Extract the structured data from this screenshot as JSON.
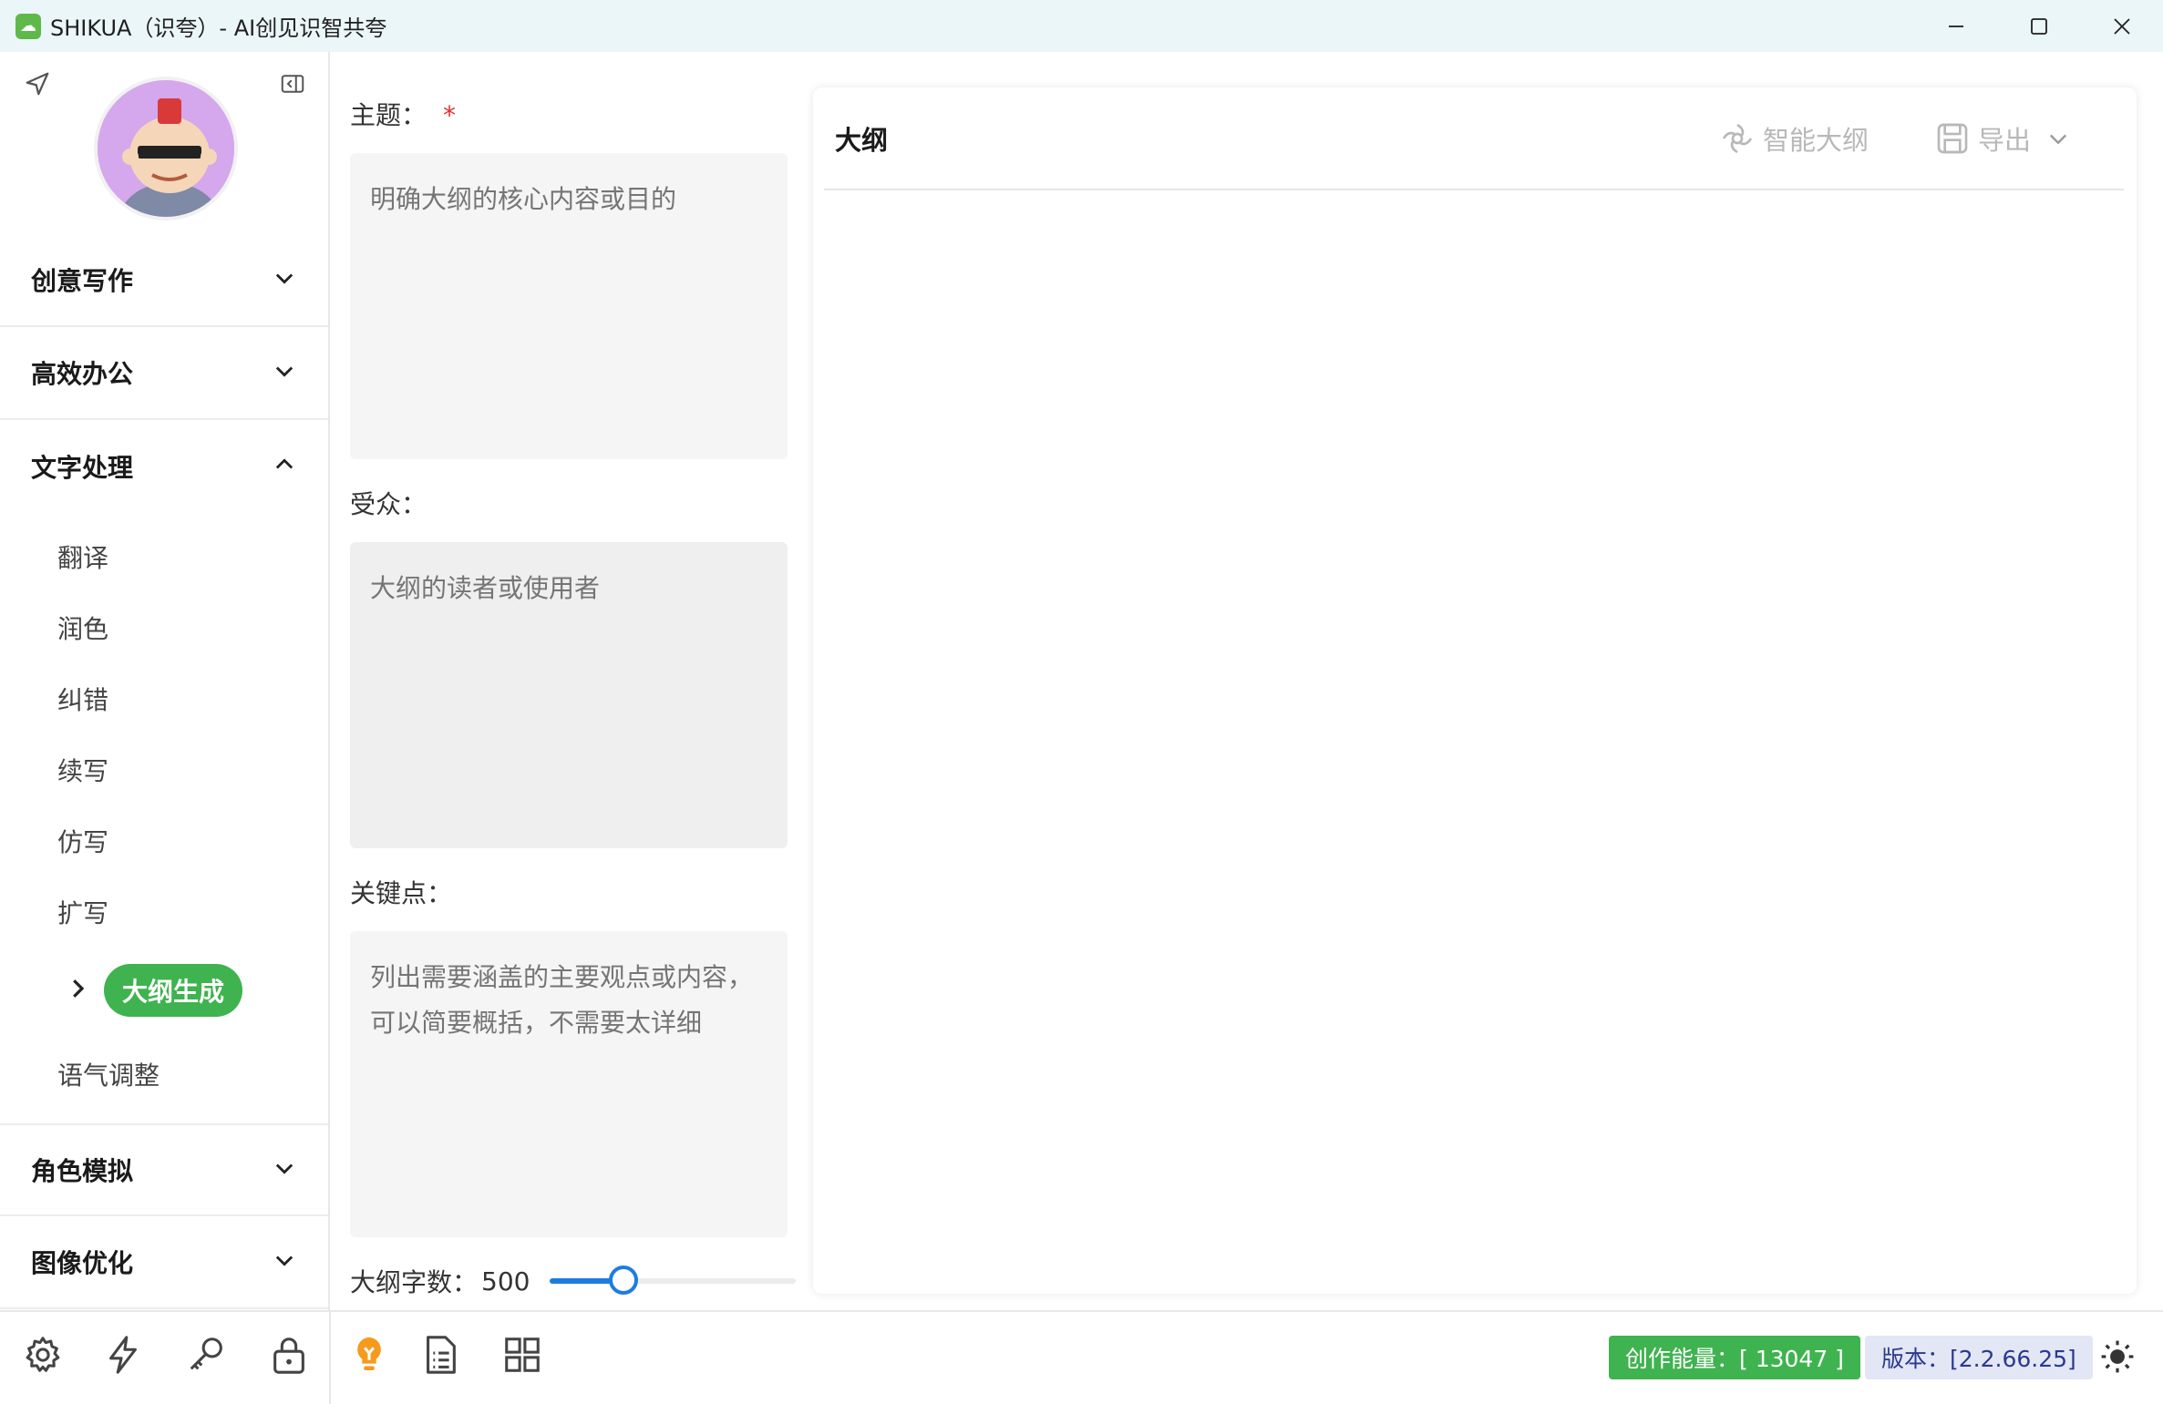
{
  "window": {
    "title": "SHIKUA（识夸）- AI创见识智共夸",
    "app_icon": "cloud-leaf-icon"
  },
  "colors": {
    "accent_green": "#3fb34f",
    "slider_blue": "#1e7ce0",
    "titlebar_bg": "#ebf6f8",
    "required_red": "#e03030"
  },
  "sidebar": {
    "groups": [
      {
        "label": "创意写作",
        "expanded": false
      },
      {
        "label": "高效办公",
        "expanded": false
      },
      {
        "label": "文字处理",
        "expanded": true
      },
      {
        "label": "角色模拟",
        "expanded": false
      },
      {
        "label": "图像优化",
        "expanded": false
      }
    ],
    "text_processing_items": [
      "翻译",
      "润色",
      "纠错",
      "续写",
      "仿写",
      "扩写",
      "大纲生成",
      "语气调整"
    ],
    "active_item": "大纲生成"
  },
  "form": {
    "topic": {
      "label": "主题：",
      "required_mark": "*",
      "placeholder": "明确大纲的核心内容或目的",
      "value": ""
    },
    "audience": {
      "label": "受众：",
      "placeholder": "大纲的读者或使用者",
      "value": ""
    },
    "key_points": {
      "label": "关键点：",
      "placeholder": "列出需要涵盖的主要观点或内容，可以简要概括，不需要太详细",
      "value": ""
    },
    "word_count": {
      "label": "大纲字数：",
      "value": "500",
      "fraction": 0.3
    }
  },
  "outline_panel": {
    "title": "大纲",
    "smart_outline_label": "智能大纲",
    "export_label": "导出"
  },
  "bottom_bar": {
    "energy_badge": "创作能量：[ 13047 ]",
    "version_badge": "版本：[2.2.66.25]"
  }
}
